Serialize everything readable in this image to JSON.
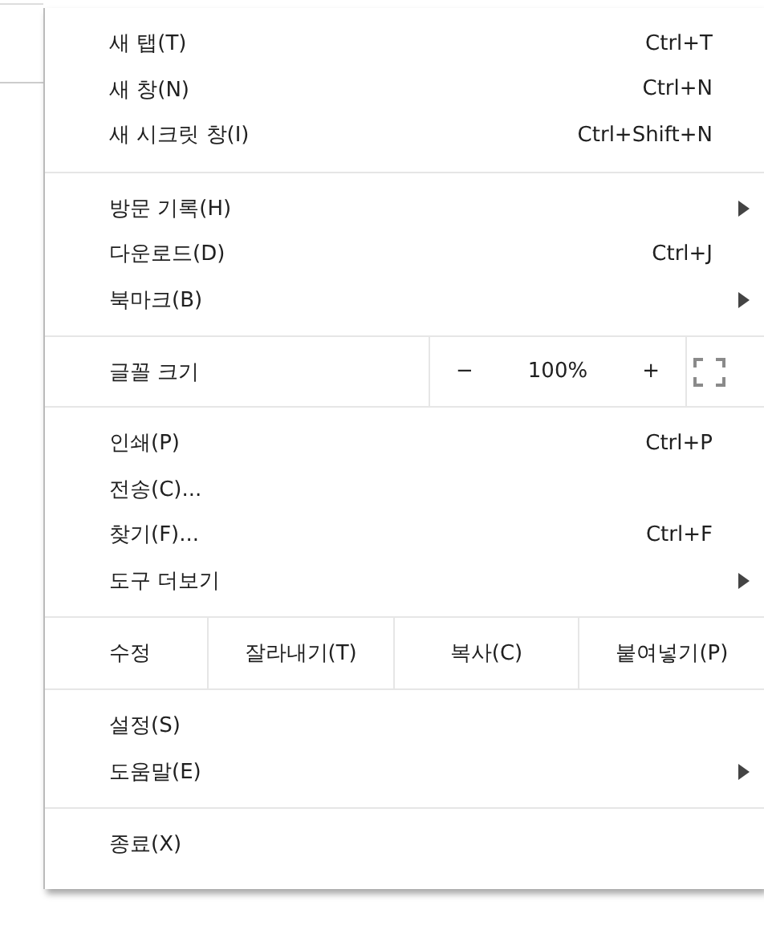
{
  "sections": [
    {
      "items": [
        {
          "kind": "item",
          "label": "새 탭(T)",
          "shortcut": "Ctrl+T",
          "submenu": false
        },
        {
          "kind": "item",
          "label": "새 창(N)",
          "shortcut": "Ctrl+N",
          "submenu": false
        },
        {
          "kind": "item",
          "label": "새 시크릿 창(I)",
          "shortcut": "Ctrl+Shift+N",
          "submenu": false
        }
      ]
    },
    {
      "items": [
        {
          "kind": "item",
          "label": "방문 기록(H)",
          "submenu": true
        },
        {
          "kind": "item",
          "label": "다운로드(D)",
          "shortcut": "Ctrl+J",
          "submenu": false
        },
        {
          "kind": "item",
          "label": "북마크(B)",
          "submenu": true
        }
      ]
    },
    {
      "items": [
        {
          "kind": "zoom",
          "label": "글꼴 크기",
          "minus": "−",
          "value": "100%",
          "plus": "+"
        }
      ]
    },
    {
      "items": [
        {
          "kind": "item",
          "label": "인쇄(P)",
          "shortcut": "Ctrl+P",
          "submenu": false
        },
        {
          "kind": "item",
          "label": "전송(C)...",
          "submenu": false
        },
        {
          "kind": "item",
          "label": "찾기(F)...",
          "shortcut": "Ctrl+F",
          "submenu": false
        },
        {
          "kind": "item",
          "label": "도구 더보기",
          "submenu": true
        }
      ]
    },
    {
      "items": [
        {
          "kind": "edit",
          "label": "수정",
          "buttons": [
            "잘라내기(T)",
            "복사(C)",
            "붙여넣기(P)"
          ]
        }
      ]
    },
    {
      "items": [
        {
          "kind": "item",
          "label": "설정(S)",
          "submenu": false
        },
        {
          "kind": "item",
          "label": "도움말(E)",
          "submenu": true
        }
      ]
    },
    {
      "items": [
        {
          "kind": "item",
          "label": "종료(X)",
          "submenu": false
        }
      ]
    }
  ]
}
